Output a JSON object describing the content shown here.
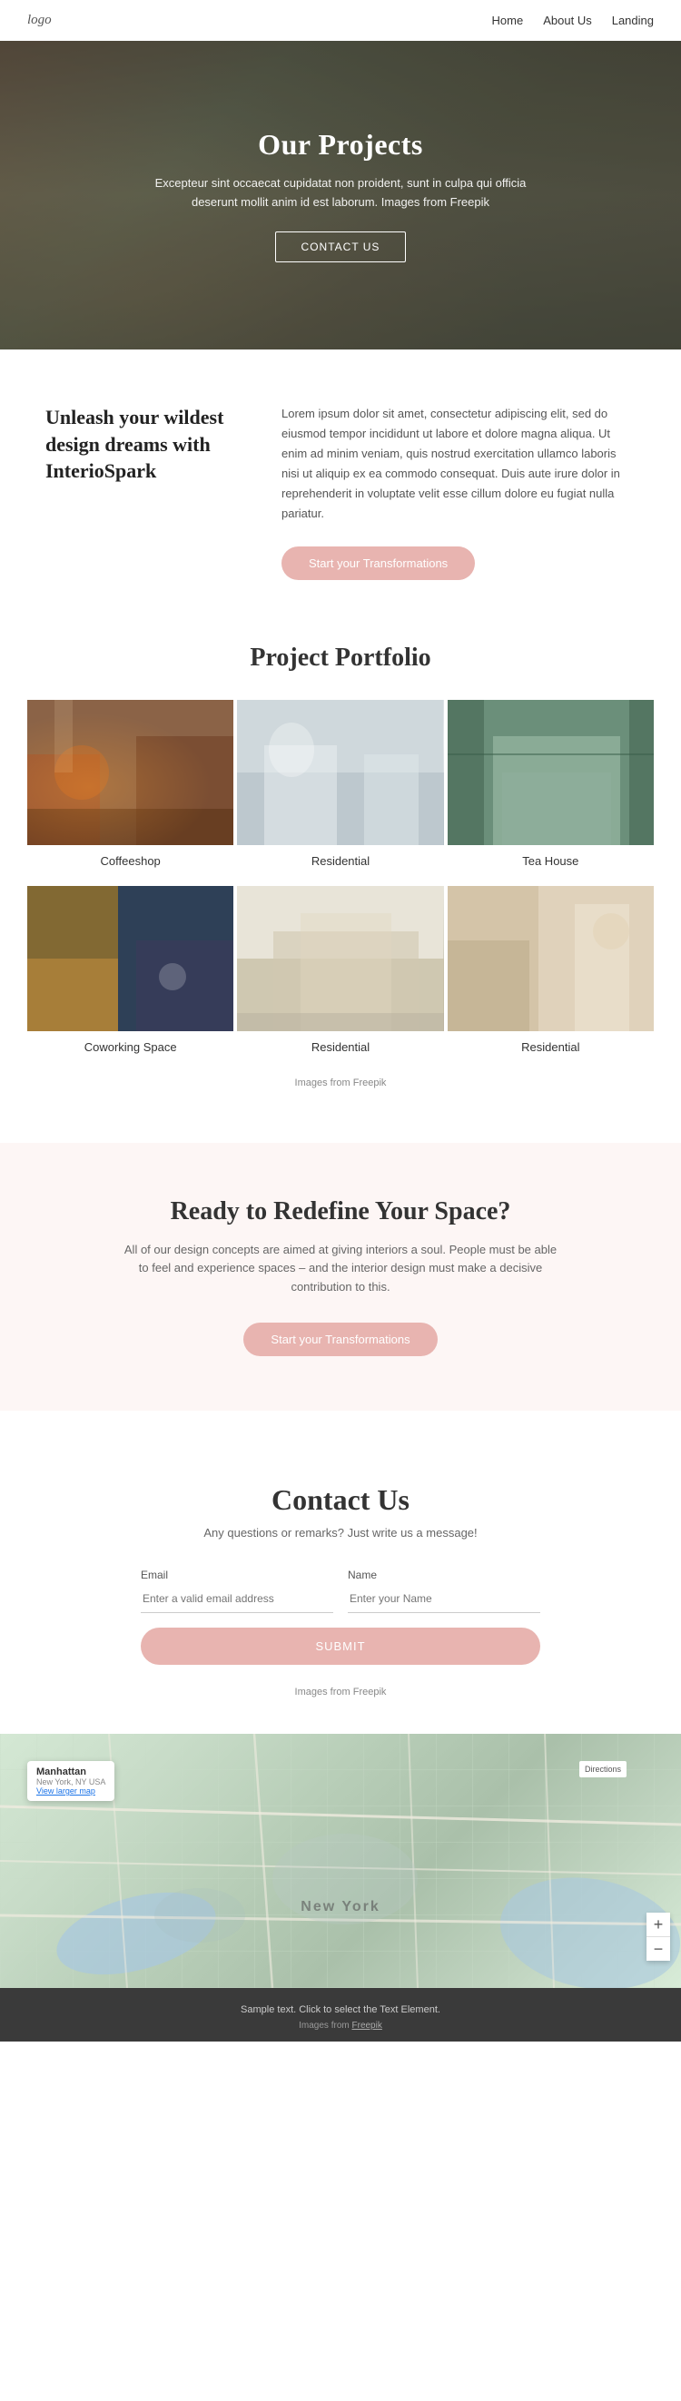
{
  "nav": {
    "logo": "logo",
    "links": [
      {
        "label": "Home",
        "href": "#"
      },
      {
        "label": "About Us",
        "href": "#"
      },
      {
        "label": "Landing",
        "href": "#"
      }
    ]
  },
  "hero": {
    "title": "Our Projects",
    "description": "Excepteur sint occaecat cupidatat non proident, sunt in culpa qui officia deserunt mollit anim id est laborum. Images from",
    "freepik_text": "Freepik",
    "cta_label": "CONTACT US"
  },
  "intro": {
    "heading": "Unleash your wildest design dreams with InterioSpark",
    "body": "Lorem ipsum dolor sit amet, consectetur adipiscing elit, sed do eiusmod tempor incididunt ut labore et dolore magna aliqua. Ut enim ad minim veniam, quis nostrud exercitation ullamco laboris nisi ut aliquip ex ea commodo consequat. Duis aute irure dolor in reprehenderit in voluptate velit esse cillum dolore eu fugiat nulla pariatur.",
    "cta_label": "Start your Transformations"
  },
  "portfolio": {
    "section_title": "Project Portfolio",
    "items": [
      {
        "label": "Coffeeshop",
        "img_class": "img-coffeeshop"
      },
      {
        "label": "Residential",
        "img_class": "img-residential1"
      },
      {
        "label": "Tea House",
        "img_class": "img-teahouse"
      },
      {
        "label": "Coworking Space",
        "img_class": "img-coworking"
      },
      {
        "label": "Residential",
        "img_class": "img-residential2"
      },
      {
        "label": "Residential",
        "img_class": "img-residential3"
      }
    ],
    "attribution": "Images from",
    "freepik_text": "Freepik"
  },
  "cta": {
    "title": "Ready to Redefine Your Space?",
    "description": "All of our design concepts are aimed at giving interiors a soul. People must be able to feel and experience spaces – and the interior design must make a decisive contribution to this.",
    "cta_label": "Start your Transformations"
  },
  "contact": {
    "title": "Contact Us",
    "subtitle": "Any questions or remarks? Just write us a message!",
    "email_label": "Email",
    "email_placeholder": "Enter a valid email address",
    "name_label": "Name",
    "name_placeholder": "Enter your Name",
    "submit_label": "SUBMIT",
    "attribution": "Images from",
    "freepik_text": "Freepik"
  },
  "map": {
    "pin_title": "Manhattan",
    "pin_address": "New York, NY USA",
    "pin_link": "View larger map",
    "city_label": "New York",
    "ctrl_label": "Directions"
  },
  "footer": {
    "sample_text": "Sample text. Click to select the Text Element.",
    "attribution": "Images from",
    "freepik_text": "Freepik"
  }
}
